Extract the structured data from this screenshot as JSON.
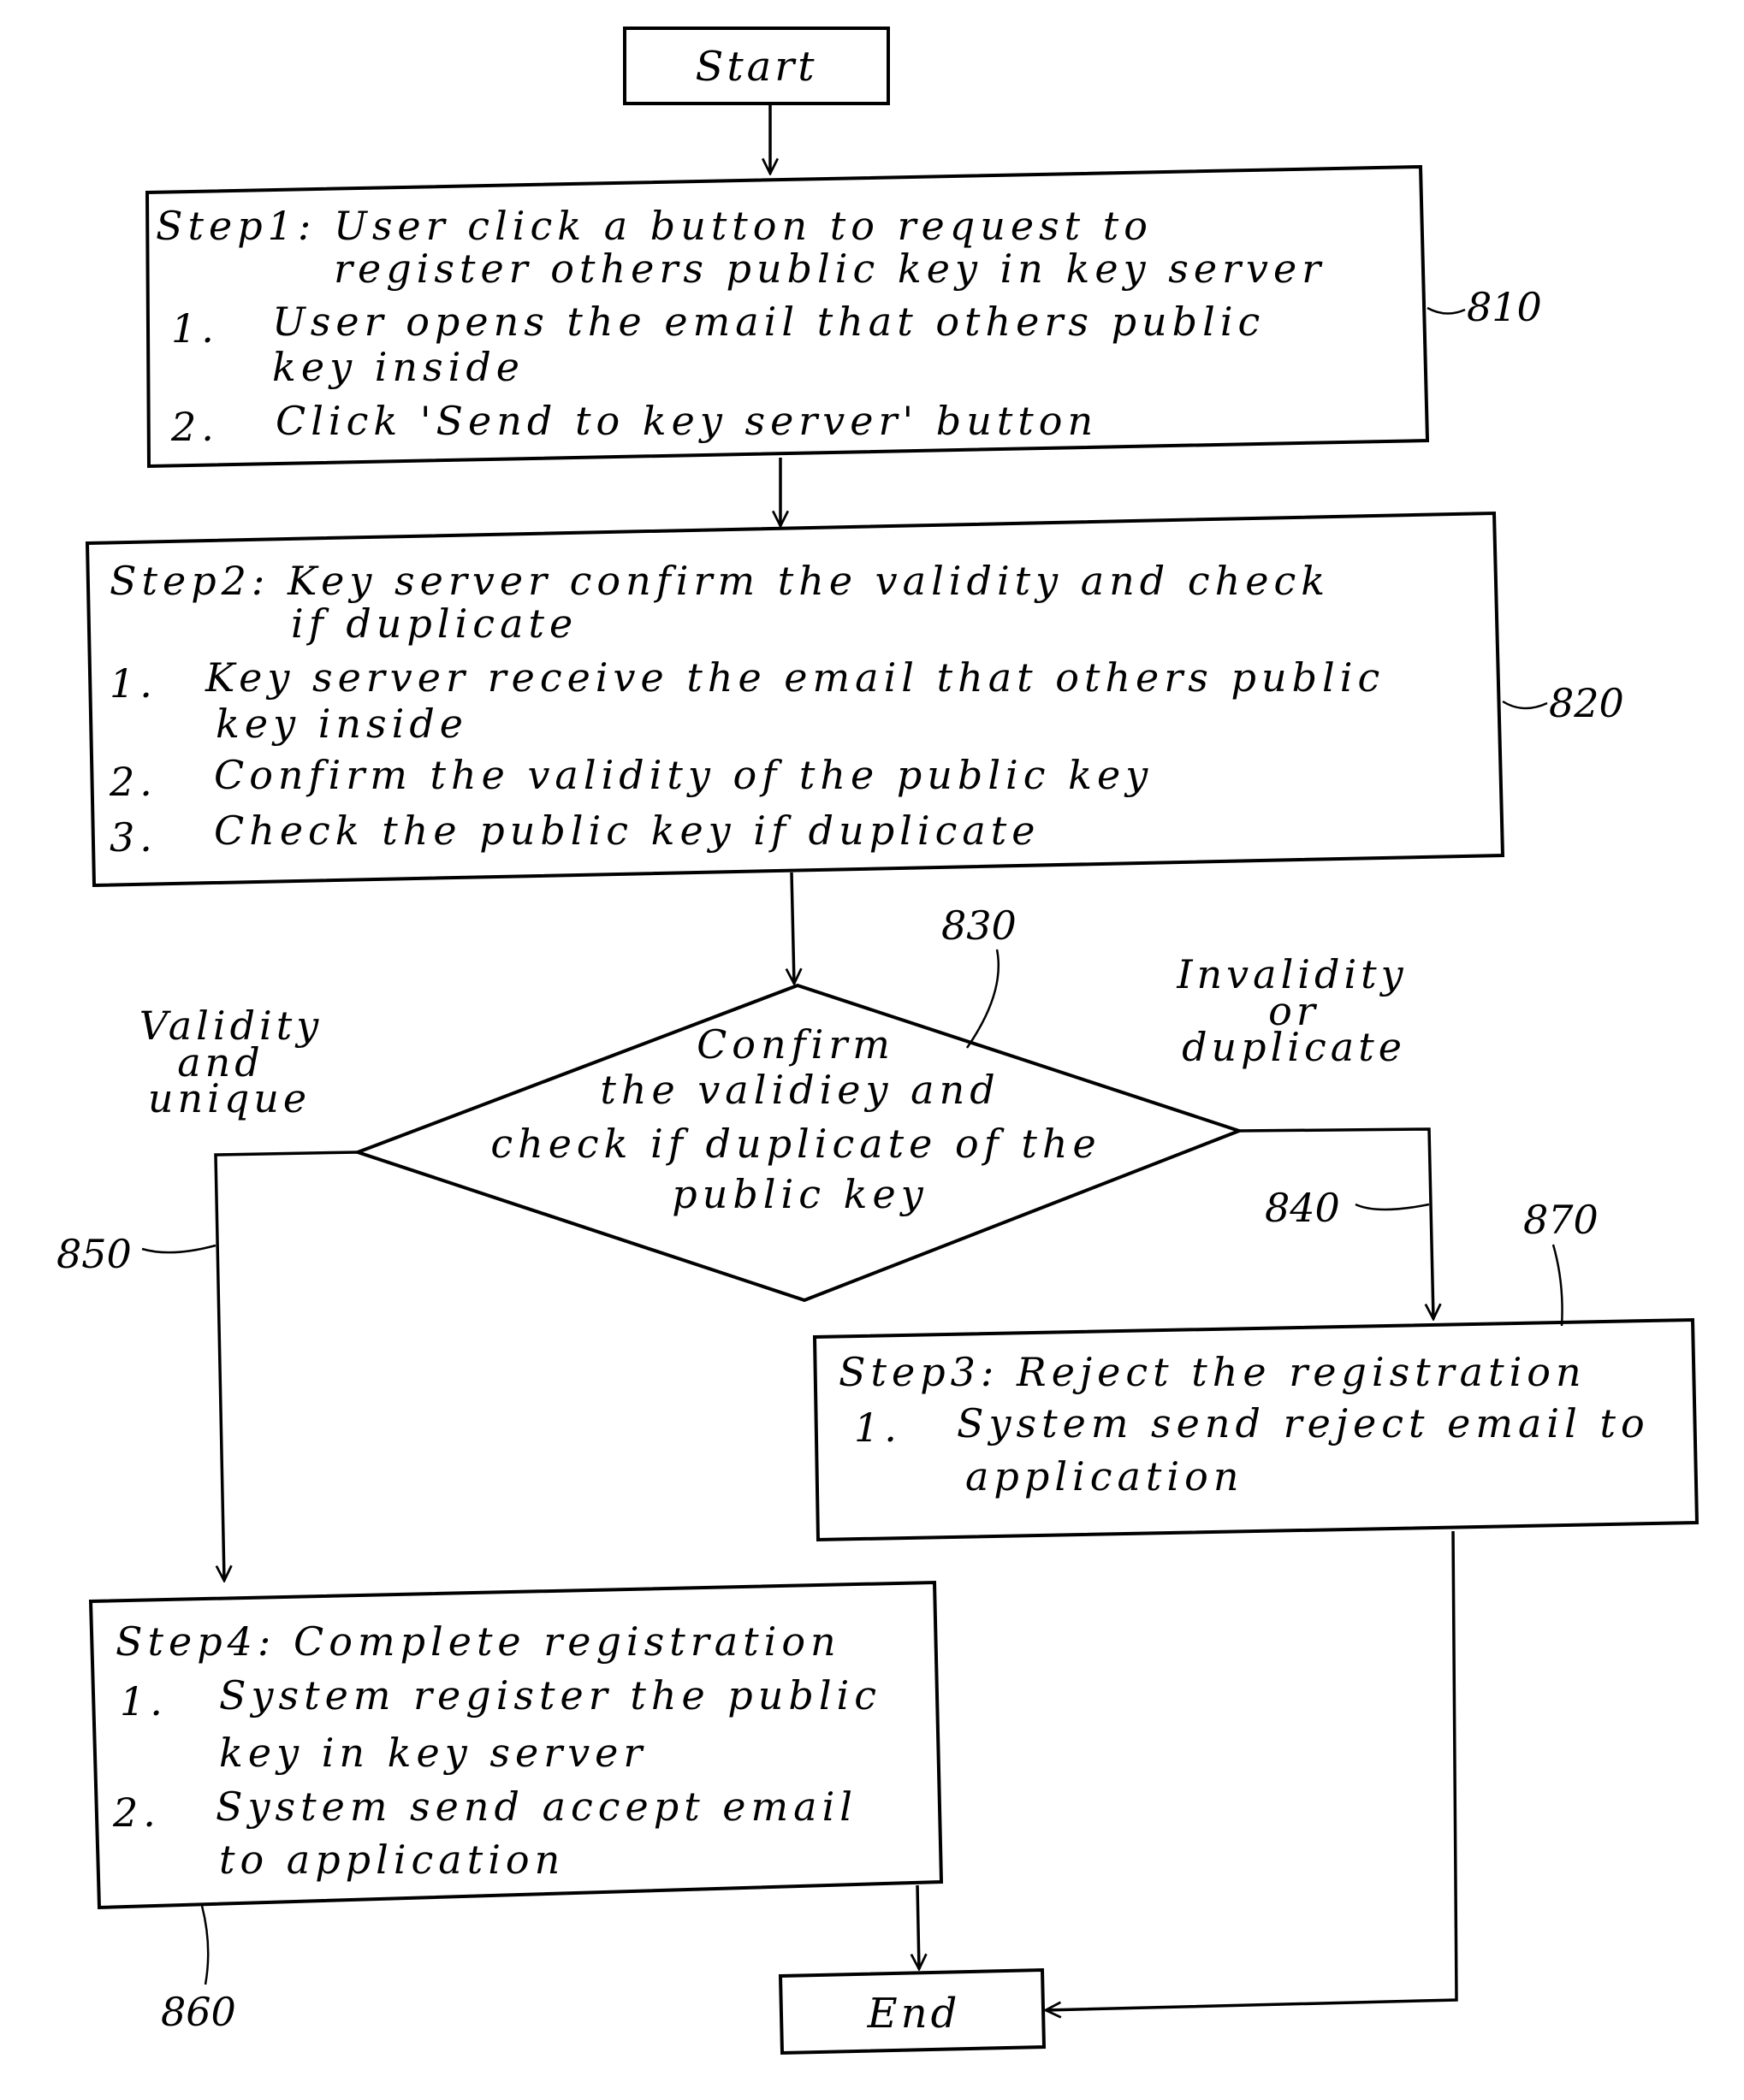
{
  "diagram": {
    "terminals": {
      "start": "Start",
      "end": "End"
    },
    "step1": {
      "ref": "810",
      "lines": [
        "Step1: User click a button to request to",
        "register others public key in key server",
        "1.",
        "User opens the email that others public",
        "key inside",
        "2.",
        "Click 'Send to key server' button"
      ]
    },
    "step2": {
      "ref": "820",
      "lines": [
        "Step2: Key server confirm the validity and check",
        "if duplicate",
        "1.",
        "Key server receive the email that others public",
        "key inside",
        "2.",
        "Confirm the validity of the public key",
        "3.",
        "Check the public key if duplicate"
      ]
    },
    "decision": {
      "ref": "830",
      "lines": [
        "Confirm",
        "the validiey and",
        "check if duplicate of the",
        "public key"
      ]
    },
    "branch_yes": {
      "ref": "850",
      "lines": [
        "Validity",
        "and",
        "unique"
      ]
    },
    "branch_no": {
      "ref": "840",
      "lines": [
        "Invalidity",
        "or",
        "duplicate"
      ]
    },
    "step3": {
      "ref": "870",
      "lines": [
        "Step3: Reject the registration",
        "1.",
        "System send reject email to",
        "application"
      ]
    },
    "step4": {
      "ref": "860",
      "lines": [
        "Step4: Complete registration",
        "1.",
        "System register the public",
        "key in key server",
        "2.",
        "System send accept email",
        "to application"
      ]
    }
  }
}
